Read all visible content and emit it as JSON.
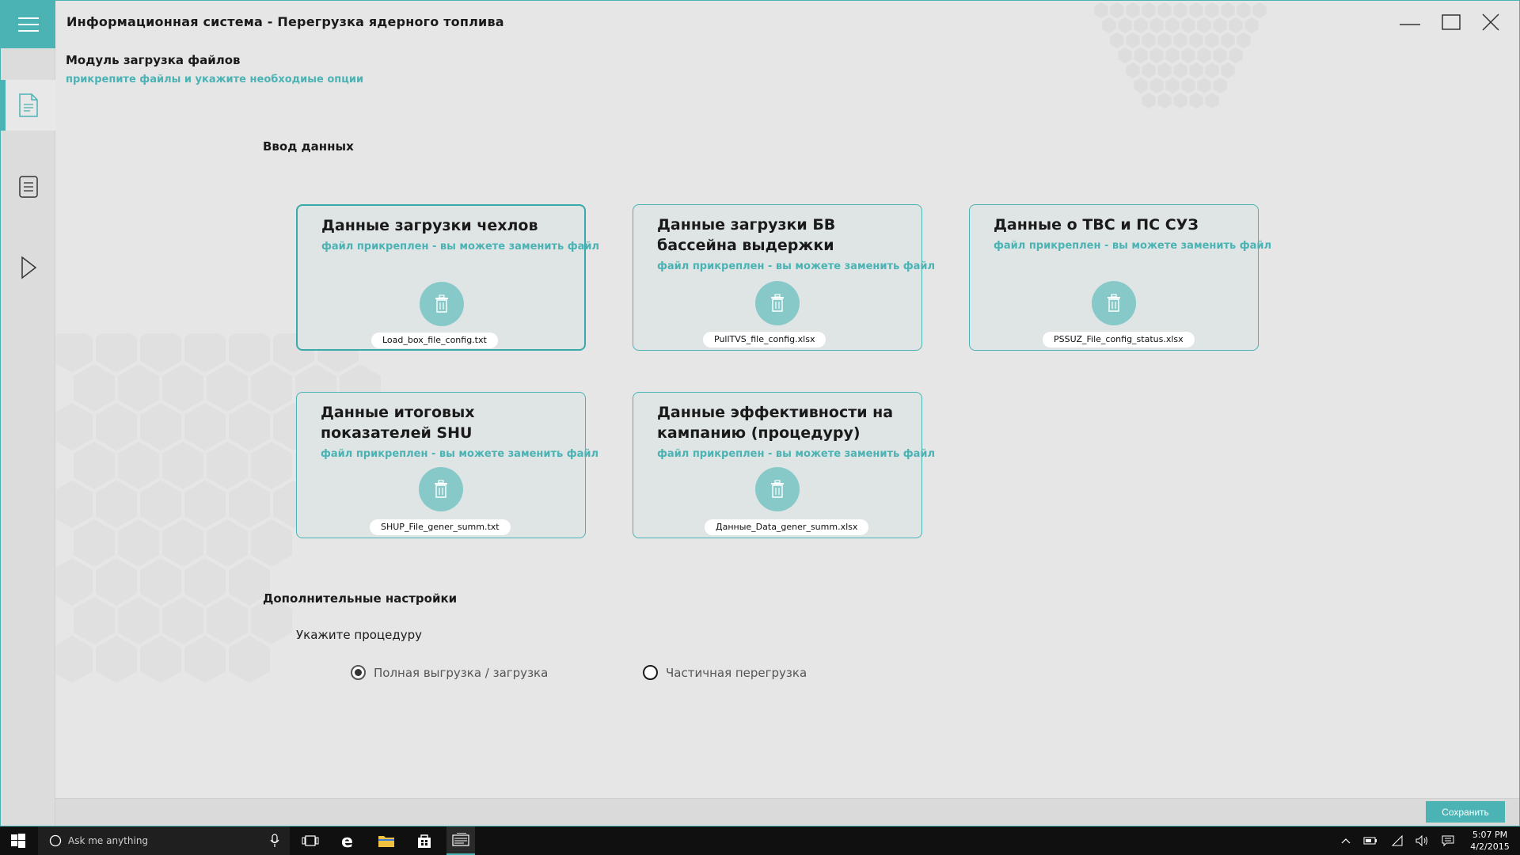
{
  "window": {
    "title": "Информационная система - Перегрузка ядерного топлива"
  },
  "sidebar": {
    "items": [
      {
        "name": "document-icon",
        "active": true
      },
      {
        "name": "list-icon",
        "active": false
      },
      {
        "name": "play-icon",
        "active": false
      }
    ]
  },
  "module": {
    "title": "Модуль загрузка файлов",
    "subtitle": "прикрепите файлы и укажите необходиые опции"
  },
  "sections": {
    "data_input": "Ввод данных",
    "additional": "Дополнительные настройки"
  },
  "cards": [
    {
      "title": "Данные загрузки чехлов",
      "status": "файл прикреплен - вы можете заменить файл",
      "file": "Load_box_file_config.txt",
      "selected": true
    },
    {
      "title": "Данные загрузки БВ бассейна выдержки",
      "status": "файл прикреплен - вы можете заменить файл",
      "file": "PullTVS_file_config.xlsx",
      "selected": false
    },
    {
      "title": "Данные о ТВС и ПС СУЗ",
      "status": "файл прикреплен - вы можете заменить файл",
      "file": "PSSUZ_File_config_status.xlsx",
      "selected": false
    },
    {
      "title": "Данные итоговых показателей SHU",
      "status": "файл прикреплен - вы можете заменить файл",
      "file": "SHUP_File_gener_summ.txt",
      "selected": false
    },
    {
      "title": "Данные эффективности на кампанию (процедуру)",
      "status": "файл прикреплен - вы можете заменить файл",
      "file": "Данные_Data_gener_summ.xlsx",
      "selected": false
    }
  ],
  "procedure": {
    "label": "Укажите процедуру",
    "options": [
      {
        "label": "Полная выгрузка / загрузка",
        "checked": true
      },
      {
        "label": "Частичная  перегрузка",
        "checked": false
      }
    ]
  },
  "footer": {
    "save_label": "Сохранить"
  },
  "taskbar": {
    "search_placeholder": "Ask me anything",
    "time": "5:07 PM",
    "date": "4/2/2015"
  },
  "colors": {
    "accent": "#4bb3b4",
    "background": "#e6e6e6",
    "card_bg": "#dfe4e4",
    "trash_circle": "#87c9c9"
  }
}
